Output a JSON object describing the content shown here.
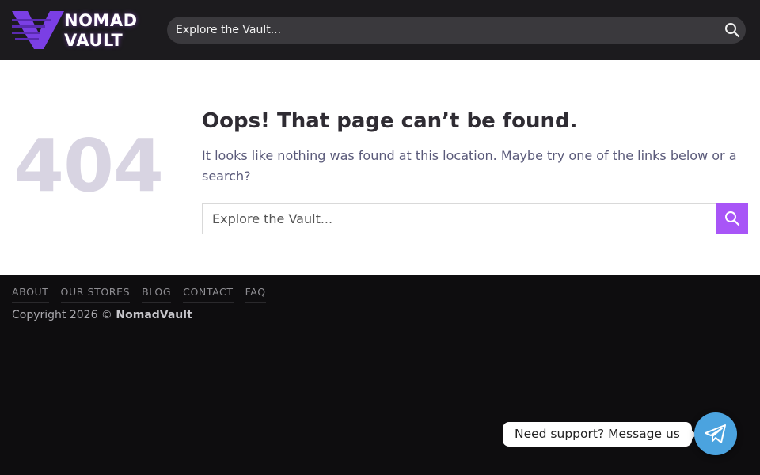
{
  "header": {
    "logo": {
      "line1": "NOMAD",
      "line2": "VAULT",
      "icon": "nomad-vault-logo-icon"
    },
    "search": {
      "placeholder": "Explore the Vault...",
      "icon": "search-icon"
    }
  },
  "main": {
    "code": "404",
    "title": "Oops! That page can’t be found.",
    "description": "It looks like nothing was found at this location. Maybe try one of the links below or a search?",
    "search": {
      "placeholder": "Explore the Vault...",
      "icon": "search-icon"
    }
  },
  "footer": {
    "nav": [
      "ABOUT",
      "OUR STORES",
      "BLOG",
      "CONTACT",
      "FAQ"
    ],
    "copyright_prefix": "Copyright 2026 © ",
    "copyright_brand": "NomadVault"
  },
  "support": {
    "label": "Need support? Message us",
    "icon": "telegram-icon"
  },
  "colors": {
    "accent": "#a855f7",
    "header_bg": "#1c1b1e",
    "footer_bg": "#0e0d0f",
    "telegram": "#4ba3df"
  }
}
